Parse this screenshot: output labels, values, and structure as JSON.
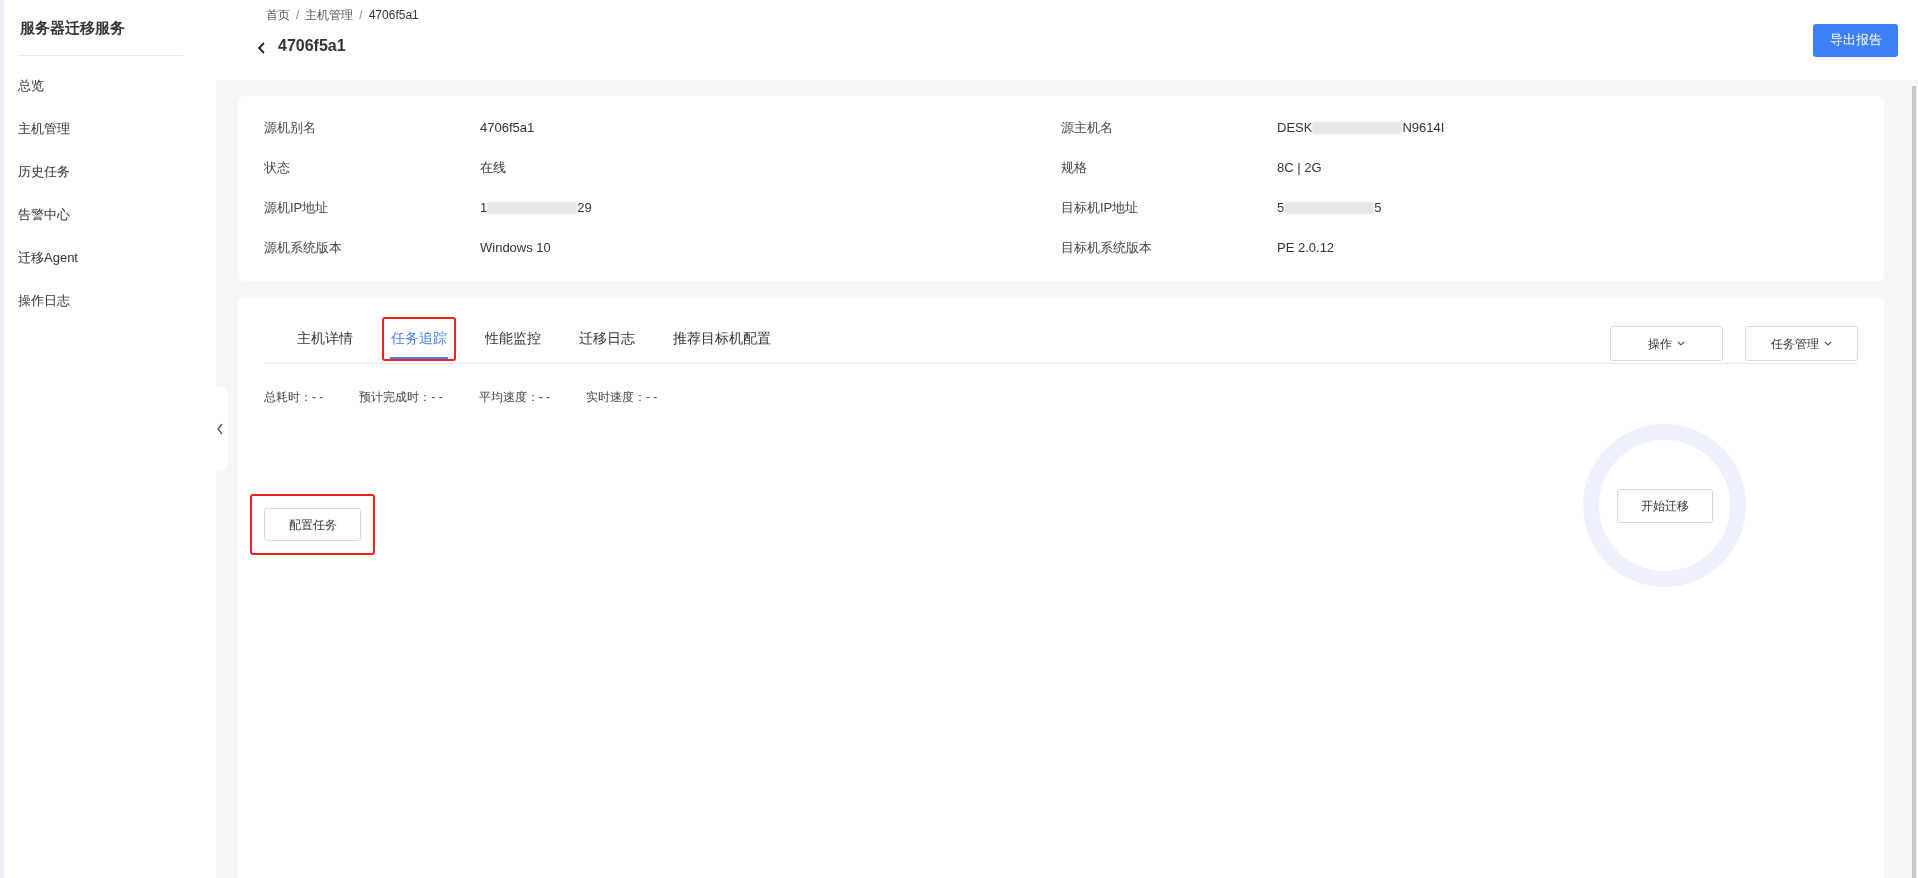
{
  "sidebar": {
    "title": "服务器迁移服务",
    "items": [
      {
        "label": "总览",
        "selected": false
      },
      {
        "label": "主机管理",
        "selected": false
      },
      {
        "label": "历史任务",
        "selected": false
      },
      {
        "label": "告警中心",
        "selected": false
      },
      {
        "label": "迁移Agent",
        "selected": false
      },
      {
        "label": "操作日志",
        "selected": false
      }
    ]
  },
  "breadcrumb": [
    "首页",
    "主机管理",
    "4706f5a1"
  ],
  "breadcrumb_separator": "/",
  "page_title": "4706f5a1",
  "export_button": "导出报告",
  "info": [
    {
      "label": "源机别名",
      "value": "4706f5a1",
      "redacted": false
    },
    {
      "label": "源主机名",
      "value": "DESK",
      "redacted": true,
      "value_end": "N9614I"
    },
    {
      "label": "状态",
      "value": "在线",
      "redacted": false
    },
    {
      "label": "规格",
      "value": "8C | 2G",
      "redacted": false
    },
    {
      "label": "源机IP地址",
      "value": "1",
      "redacted": true,
      "value_end": "29"
    },
    {
      "label": "目标机IP地址",
      "value": "5",
      "redacted": true,
      "value_end": "5"
    },
    {
      "label": "源机系统版本",
      "value": "Windows 10",
      "redacted": false
    },
    {
      "label": "目标机系统版本",
      "value": "PE 2.0.12",
      "redacted": false
    }
  ],
  "tabs": [
    {
      "label": "主机详情",
      "selected": false,
      "highlighted": false
    },
    {
      "label": "任务追踪",
      "selected": true,
      "highlighted": true
    },
    {
      "label": "性能监控",
      "selected": false,
      "highlighted": false
    },
    {
      "label": "迁移日志",
      "selected": false,
      "highlighted": false
    },
    {
      "label": "推荐目标机配置",
      "selected": false,
      "highlighted": false
    }
  ],
  "dropdowns": [
    "操作",
    "任务管理"
  ],
  "stats": [
    {
      "label": "总耗时：",
      "value": "- -"
    },
    {
      "label": "预计完成时：",
      "value": "- -"
    },
    {
      "label": "平均速度：",
      "value": "- -"
    },
    {
      "label": "实时速度：",
      "value": "- -"
    }
  ],
  "configure_button": {
    "label": "配置任务",
    "highlighted": true
  },
  "start_button": "开始迁移"
}
